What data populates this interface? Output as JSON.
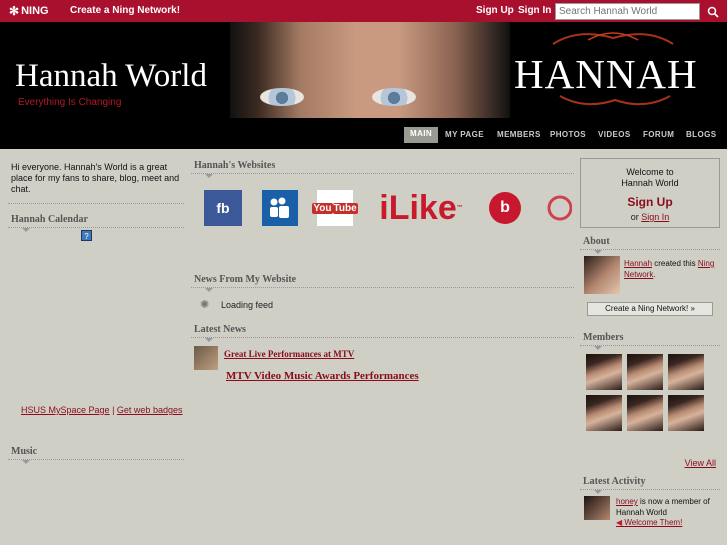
{
  "ningbar": {
    "logo": "NING",
    "create_link": "Create a Ning Network!",
    "signup": "Sign Up",
    "signin": "Sign In",
    "search_placeholder": "Search Hannah World"
  },
  "banner": {
    "title": "Hannah World",
    "tagline": "Everything Is Changing",
    "brand": "HANNAH"
  },
  "nav": {
    "tabs": [
      {
        "label": "MAIN",
        "active": true
      },
      {
        "label": "MY PAGE"
      },
      {
        "label": "MEMBERS"
      },
      {
        "label": "PHOTOS"
      },
      {
        "label": "VIDEOS"
      },
      {
        "label": "FORUM"
      },
      {
        "label": "BLOGS"
      }
    ]
  },
  "left": {
    "intro": "Hi everyone. Hannah's World is a great place for my fans to share, blog, meet and chat.",
    "calendar_title": "Hannah Calendar",
    "calendar_badge": "?",
    "calendar_link1": "HSUS MySpace Page",
    "calendar_sep": "|",
    "calendar_link2": "Get web badges",
    "music_title": "Music"
  },
  "middle": {
    "websites_title": "Hannah's Websites",
    "sites": {
      "fb": "fb",
      "youtube_you": "You",
      "youtube_tube": "Tube",
      "ilike": "iLike",
      "ilike_tm": "™",
      "bebo": "b"
    },
    "news_site_title": "News From My Website",
    "loading": "Loading feed",
    "latest_title": "Latest News",
    "news": [
      "Great Live Performances at MTV",
      "MTV Video Music Awards Performances"
    ]
  },
  "right": {
    "welcome_line1": "Welcome to",
    "welcome_line2": "Hannah World",
    "signup": "Sign Up",
    "or": "or",
    "signin": "Sign In",
    "about_title": "About",
    "about_user": "Hannah",
    "about_created": " created this ",
    "about_network": "Ning Network",
    "about_end": ".",
    "create_btn": "Create a Ning Network! »",
    "members_title": "Members",
    "view_all": "View All",
    "activity_title": "Latest Activity",
    "activity_user": "honey",
    "activity_text": " is now a member of Hannah World",
    "welcome_them": "Welcome Them!"
  }
}
